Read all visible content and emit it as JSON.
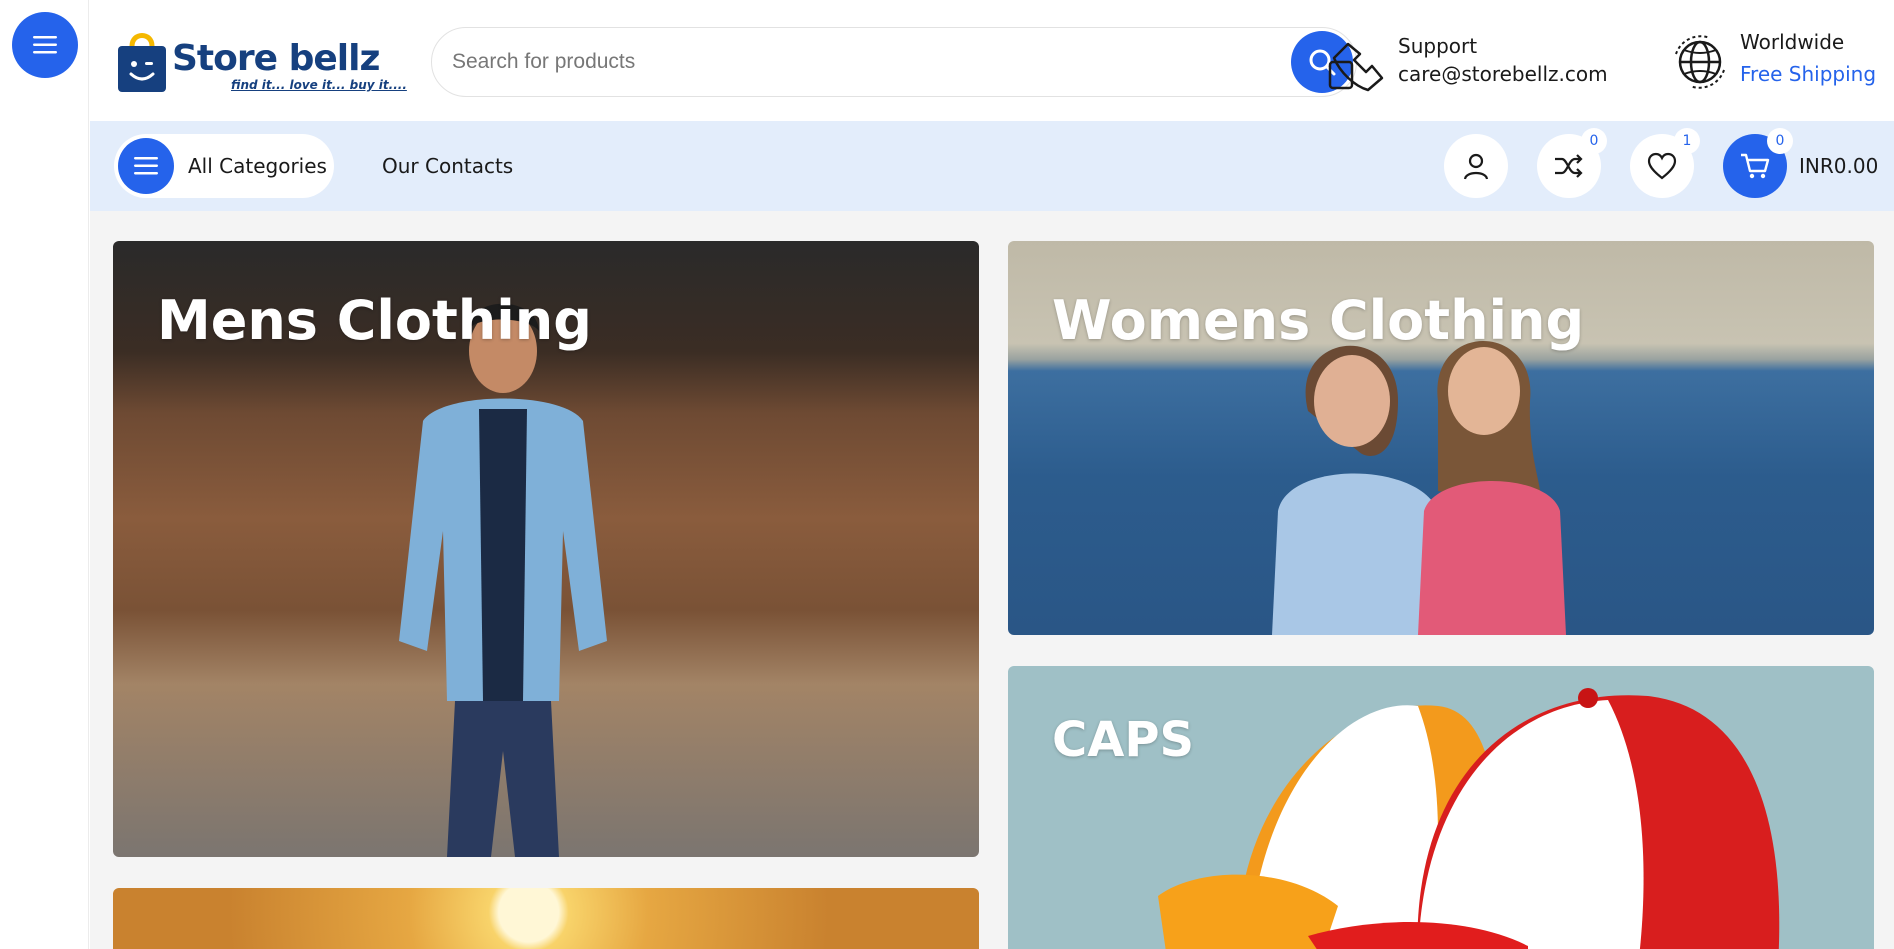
{
  "header": {
    "logo_text": "Store bellz",
    "logo_tagline": "find it... love it... buy it....",
    "search_placeholder": "Search for products",
    "support": {
      "title": "Support",
      "email": "care@storebellz.com"
    },
    "shipping": {
      "title": "Worldwide",
      "subtitle": "Free Shipping"
    }
  },
  "nav": {
    "all_categories": "All Categories",
    "our_contacts": "Our Contacts",
    "compare_count": "0",
    "wishlist_count": "1",
    "cart_count": "0",
    "cart_total": "INR0.00"
  },
  "categories": [
    {
      "title": "Mens Clothing"
    },
    {
      "title": "Womens Clothing"
    },
    {
      "title": "CAPS"
    }
  ],
  "colors": {
    "accent": "#2563eb",
    "brand": "#16407f",
    "nav_bg": "#e3edfb"
  },
  "icons": [
    "menu-icon",
    "bag-logo-icon",
    "search-icon",
    "support-phone-icon",
    "globe-icon",
    "user-icon",
    "shuffle-icon",
    "heart-icon",
    "cart-icon"
  ]
}
